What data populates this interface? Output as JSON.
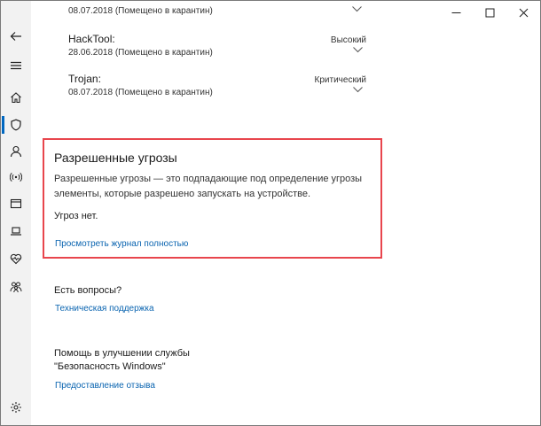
{
  "titlebar": {
    "minimize": "minimize",
    "maximize": "maximize",
    "close": "close"
  },
  "rail": {
    "items": [
      {
        "name": "back-icon"
      },
      {
        "name": "menu-icon"
      },
      {
        "name": "home-icon"
      },
      {
        "name": "shield-icon",
        "selected": true
      },
      {
        "name": "account-icon"
      },
      {
        "name": "wireless-icon"
      },
      {
        "name": "browser-icon"
      },
      {
        "name": "laptop-icon"
      },
      {
        "name": "heart-icon"
      },
      {
        "name": "family-icon"
      },
      {
        "name": "settings-icon"
      }
    ],
    "accent": "#0067c0"
  },
  "threat_history": {
    "top_date": "08.07.2018 (Помещено в карантин)",
    "items": [
      {
        "name": "HackTool:",
        "date": "28.06.2018 (Помещено в карантин)",
        "level": "Высокий"
      },
      {
        "name": "Trojan:",
        "date": "08.07.2018 (Помещено в карантин)",
        "level": "Критический"
      }
    ]
  },
  "allowed_threats": {
    "title": "Разрешенные угрозы",
    "description": "Разрешенные угрозы — это подпадающие под определение угрозы элементы, которые разрешено запускать на устройстве.",
    "empty_text": "Угроз нет.",
    "view_full_log_link": "Просмотреть журнал полностью",
    "highlight_color": "#e8454d"
  },
  "help": {
    "title": "Есть вопросы?",
    "link": "Техническая поддержка"
  },
  "improve": {
    "title_line1": "Помощь в улучшении службы",
    "title_line2": "\"Безопасность Windows\"",
    "link": "Предоставление отзыва"
  },
  "link_color": "#0a64b0"
}
